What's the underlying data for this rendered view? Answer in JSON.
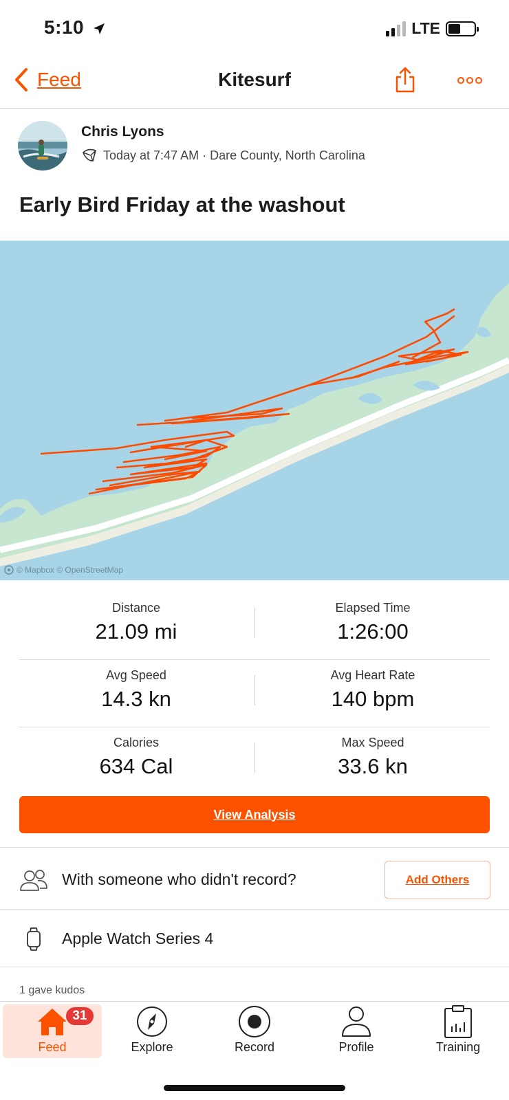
{
  "status_bar": {
    "time": "5:10",
    "network": "LTE"
  },
  "nav": {
    "back_label": "Feed",
    "title": "Kitesurf"
  },
  "athlete": {
    "name": "Chris Lyons",
    "meta": "Today at 7:47 AM · Dare County, North Carolina"
  },
  "activity": {
    "title": "Early Bird Friday at the washout"
  },
  "map": {
    "attribution": "© Mapbox © OpenStreetMap"
  },
  "stats": [
    {
      "label": "Distance",
      "value": "21.09 mi"
    },
    {
      "label": "Elapsed Time",
      "value": "1:26:00"
    },
    {
      "label": "Avg Speed",
      "value": "14.3 kn"
    },
    {
      "label": "Avg Heart Rate",
      "value": "140 bpm"
    },
    {
      "label": "Calories",
      "value": "634 Cal"
    },
    {
      "label": "Max Speed",
      "value": "33.6 kn"
    }
  ],
  "actions": {
    "view_analysis": "View Analysis",
    "with_others": "With someone who didn't record?",
    "add_others": "Add Others",
    "device": "Apple Watch Series 4"
  },
  "kudos": "1 gave kudos",
  "tabs": [
    {
      "label": "Feed",
      "icon": "home-icon",
      "badge": "31"
    },
    {
      "label": "Explore",
      "icon": "compass-icon"
    },
    {
      "label": "Record",
      "icon": "record-icon"
    },
    {
      "label": "Profile",
      "icon": "profile-icon"
    },
    {
      "label": "Training",
      "icon": "training-icon"
    }
  ],
  "colors": {
    "accent": "#fc5200",
    "route": "#fc4c02",
    "water": "#a8d4e8",
    "land": "#c7e6cf",
    "badge": "#e53935"
  }
}
